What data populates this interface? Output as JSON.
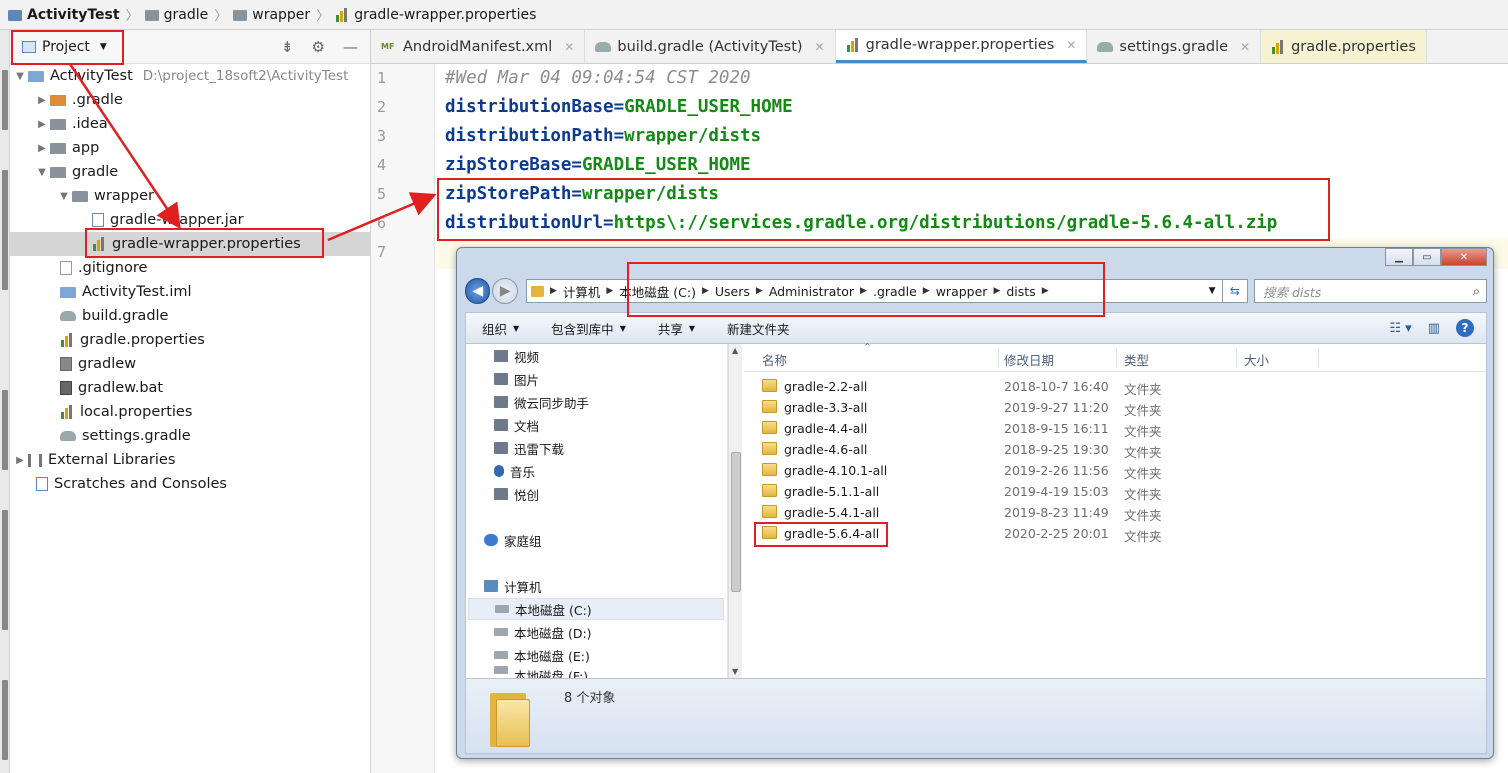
{
  "breadcrumb": {
    "items": [
      {
        "label": "ActivityTest",
        "icon": "project-icon"
      },
      {
        "label": "gradle",
        "icon": "folder-icon"
      },
      {
        "label": "wrapper",
        "icon": "folder-icon"
      },
      {
        "label": "gradle-wrapper.properties",
        "icon": "properties-file-icon"
      }
    ]
  },
  "project_panel": {
    "title": "Project",
    "tree": [
      {
        "label": "ActivityTest",
        "path": "D:\\project_18soft2\\ActivityTest"
      },
      {
        "label": ".gradle"
      },
      {
        "label": ".idea"
      },
      {
        "label": "app"
      },
      {
        "label": "gradle"
      },
      {
        "label": "wrapper"
      },
      {
        "label": "gradle-wrapper.jar"
      },
      {
        "label": "gradle-wrapper.properties"
      },
      {
        "label": ".gitignore"
      },
      {
        "label": "ActivityTest.iml"
      },
      {
        "label": "build.gradle"
      },
      {
        "label": "gradle.properties"
      },
      {
        "label": "gradlew"
      },
      {
        "label": "gradlew.bat"
      },
      {
        "label": "local.properties"
      },
      {
        "label": "settings.gradle"
      },
      {
        "label": "External Libraries"
      },
      {
        "label": "Scratches and Consoles"
      }
    ]
  },
  "tabs": [
    {
      "label": "AndroidManifest.xml",
      "icon": "manifest-icon"
    },
    {
      "label": "build.gradle (ActivityTest)",
      "icon": "gradle-elephant-icon"
    },
    {
      "label": "gradle-wrapper.properties",
      "icon": "properties-file-icon"
    },
    {
      "label": "settings.gradle",
      "icon": "gradle-elephant-icon"
    },
    {
      "label": "gradle.properties",
      "icon": "properties-file-icon"
    }
  ],
  "editor": {
    "line_numbers": [
      "1",
      "2",
      "3",
      "4",
      "5",
      "6",
      "7"
    ],
    "comment": "#Wed Mar 04 09:04:54 CST 2020",
    "lines": [
      {
        "key": "distributionBase=",
        "value": "GRADLE_USER_HOME"
      },
      {
        "key": "distributionPath=",
        "value": "wrapper/dists"
      },
      {
        "key": "zipStoreBase=",
        "value": "GRADLE_USER_HOME"
      },
      {
        "key": "zipStorePath=",
        "value": "wrapper/dists"
      },
      {
        "key": "distributionUrl=",
        "value": "https\\://services.gradle.org/distributions/gradle-5.6.4-all.zip"
      }
    ]
  },
  "explorer": {
    "address": [
      "计算机",
      "本地磁盘 (C:)",
      "Users",
      "Administrator",
      ".gradle",
      "wrapper",
      "dists"
    ],
    "search_placeholder": "搜索 dists",
    "commands": [
      "组织",
      "包含到库中",
      "共享",
      "新建文件夹"
    ],
    "nav": [
      "视频",
      "图片",
      "微云同步助手",
      "文档",
      "迅雷下载",
      "音乐",
      "悦创",
      "家庭组",
      "计算机",
      "本地磁盘 (C:)",
      "本地磁盘 (D:)",
      "本地磁盘 (E:)",
      "本地磁盘 (F:)"
    ],
    "columns": [
      "名称",
      "修改日期",
      "类型",
      "大小"
    ],
    "files": [
      {
        "name": "gradle-2.2-all",
        "date": "2018-10-7 16:40",
        "type": "文件夹"
      },
      {
        "name": "gradle-3.3-all",
        "date": "2019-9-27 11:20",
        "type": "文件夹"
      },
      {
        "name": "gradle-4.4-all",
        "date": "2018-9-15 16:11",
        "type": "文件夹"
      },
      {
        "name": "gradle-4.6-all",
        "date": "2018-9-25 19:30",
        "type": "文件夹"
      },
      {
        "name": "gradle-4.10.1-all",
        "date": "2019-2-26 11:56",
        "type": "文件夹"
      },
      {
        "name": "gradle-5.1.1-all",
        "date": "2019-4-19 15:03",
        "type": "文件夹"
      },
      {
        "name": "gradle-5.4.1-all",
        "date": "2019-8-23 11:49",
        "type": "文件夹"
      },
      {
        "name": "gradle-5.6.4-all",
        "date": "2020-2-25 20:01",
        "type": "文件夹"
      }
    ],
    "status": "8 个对象"
  },
  "colors": {
    "annotation": "#e02020",
    "key": "#0b3a8e",
    "value": "#148a14"
  }
}
